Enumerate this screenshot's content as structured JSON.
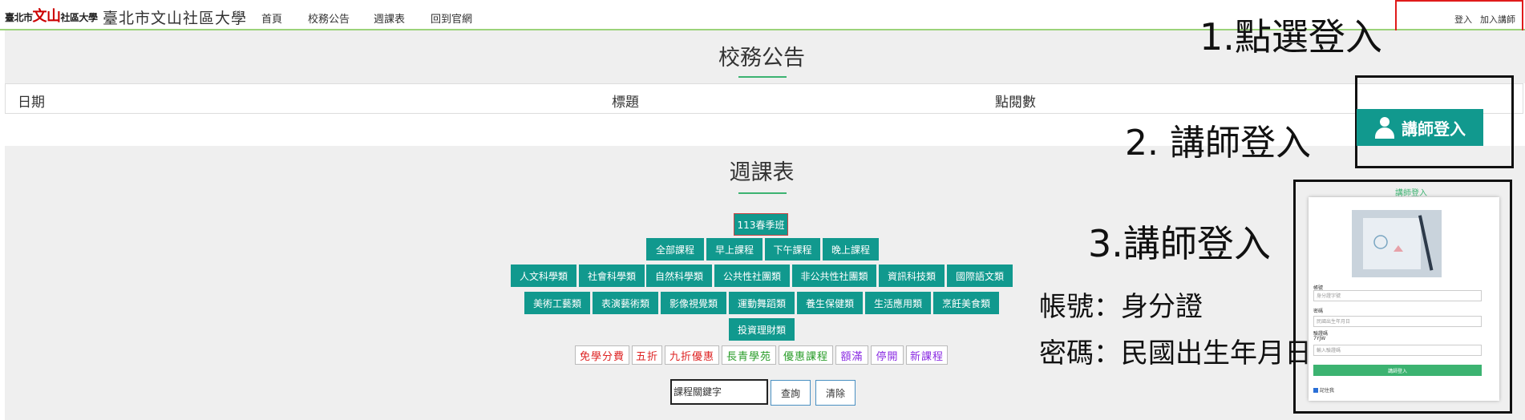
{
  "header": {
    "logo_text_a": "臺北市",
    "logo_text_b": "文山",
    "logo_text_c": "社區大學",
    "site_title": "臺北市文山社區大學",
    "nav": [
      "首頁",
      "校務公告",
      "週課表",
      "回到官網"
    ],
    "login": "登入",
    "join_teacher": "加入講師"
  },
  "announcements": {
    "heading": "校務公告",
    "columns": [
      "日期",
      "標題",
      "點閱數"
    ]
  },
  "schedule": {
    "heading": "週課表",
    "term_button": "113春季班",
    "time_filters": [
      "全部課程",
      "早上課程",
      "下午課程",
      "晚上課程"
    ],
    "categories_row1": [
      "人文科學類",
      "社會科學類",
      "自然科學類",
      "公共性社團類",
      "非公共性社團類",
      "資訊科技類",
      "國際語文類"
    ],
    "categories_row2": [
      "美術工藝類",
      "表演藝術類",
      "影像視覺類",
      "運動舞蹈類",
      "養生保健類",
      "生活應用類",
      "烹飪美食類"
    ],
    "categories_row3": [
      "投資理財類"
    ],
    "tags": [
      {
        "label": "免學分費",
        "color": "#d22"
      },
      {
        "label": "五折",
        "color": "#d22"
      },
      {
        "label": "九折優惠",
        "color": "#d22"
      },
      {
        "label": "長青學苑",
        "color": "#2a9d2a"
      },
      {
        "label": "優惠課程",
        "color": "#2a9d2a"
      },
      {
        "label": "額滿",
        "color": "#8a2be2"
      },
      {
        "label": "停開",
        "color": "#8a2be2"
      },
      {
        "label": "新課程",
        "color": "#8a2be2"
      }
    ],
    "search_placeholder": "課程關鍵字",
    "search_button": "查詢",
    "clear_button": "清除"
  },
  "annotations": {
    "step1": "1.點選登入",
    "step2": "2. 講師登入",
    "step3": "3.講師登入",
    "account_note": "帳號：身分證",
    "password_note": "密碼：民國出生年月日"
  },
  "teacher_login_button": "講師登入",
  "mini_login": {
    "title": "講師登入",
    "account_label": "帳號",
    "account_placeholder": "身分證字號",
    "password_label": "密碼",
    "password_placeholder": "民國出生年月日",
    "captcha_label": "驗證碼",
    "captcha_code": "7YJW",
    "captcha_placeholder": "輸入驗證碼",
    "submit": "講師登入",
    "remember": "記住我"
  }
}
